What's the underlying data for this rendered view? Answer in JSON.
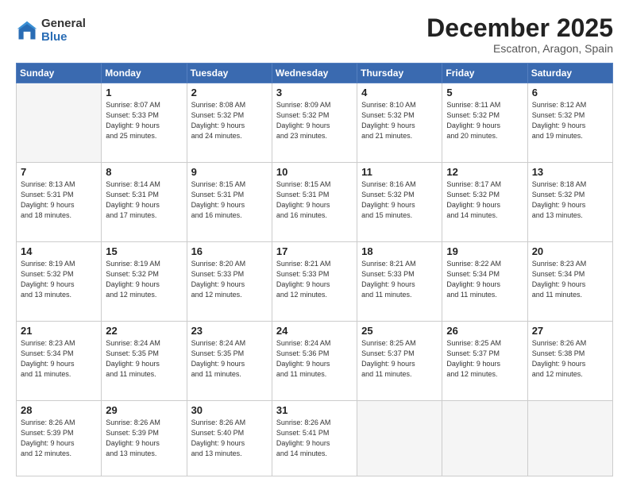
{
  "logo": {
    "general": "General",
    "blue": "Blue"
  },
  "title": "December 2025",
  "subtitle": "Escatron, Aragon, Spain",
  "weekdays": [
    "Sunday",
    "Monday",
    "Tuesday",
    "Wednesday",
    "Thursday",
    "Friday",
    "Saturday"
  ],
  "weeks": [
    [
      {
        "num": "",
        "info": ""
      },
      {
        "num": "1",
        "info": "Sunrise: 8:07 AM\nSunset: 5:33 PM\nDaylight: 9 hours\nand 25 minutes."
      },
      {
        "num": "2",
        "info": "Sunrise: 8:08 AM\nSunset: 5:32 PM\nDaylight: 9 hours\nand 24 minutes."
      },
      {
        "num": "3",
        "info": "Sunrise: 8:09 AM\nSunset: 5:32 PM\nDaylight: 9 hours\nand 23 minutes."
      },
      {
        "num": "4",
        "info": "Sunrise: 8:10 AM\nSunset: 5:32 PM\nDaylight: 9 hours\nand 21 minutes."
      },
      {
        "num": "5",
        "info": "Sunrise: 8:11 AM\nSunset: 5:32 PM\nDaylight: 9 hours\nand 20 minutes."
      },
      {
        "num": "6",
        "info": "Sunrise: 8:12 AM\nSunset: 5:32 PM\nDaylight: 9 hours\nand 19 minutes."
      }
    ],
    [
      {
        "num": "7",
        "info": "Sunrise: 8:13 AM\nSunset: 5:31 PM\nDaylight: 9 hours\nand 18 minutes."
      },
      {
        "num": "8",
        "info": "Sunrise: 8:14 AM\nSunset: 5:31 PM\nDaylight: 9 hours\nand 17 minutes."
      },
      {
        "num": "9",
        "info": "Sunrise: 8:15 AM\nSunset: 5:31 PM\nDaylight: 9 hours\nand 16 minutes."
      },
      {
        "num": "10",
        "info": "Sunrise: 8:15 AM\nSunset: 5:31 PM\nDaylight: 9 hours\nand 16 minutes."
      },
      {
        "num": "11",
        "info": "Sunrise: 8:16 AM\nSunset: 5:32 PM\nDaylight: 9 hours\nand 15 minutes."
      },
      {
        "num": "12",
        "info": "Sunrise: 8:17 AM\nSunset: 5:32 PM\nDaylight: 9 hours\nand 14 minutes."
      },
      {
        "num": "13",
        "info": "Sunrise: 8:18 AM\nSunset: 5:32 PM\nDaylight: 9 hours\nand 13 minutes."
      }
    ],
    [
      {
        "num": "14",
        "info": "Sunrise: 8:19 AM\nSunset: 5:32 PM\nDaylight: 9 hours\nand 13 minutes."
      },
      {
        "num": "15",
        "info": "Sunrise: 8:19 AM\nSunset: 5:32 PM\nDaylight: 9 hours\nand 12 minutes."
      },
      {
        "num": "16",
        "info": "Sunrise: 8:20 AM\nSunset: 5:33 PM\nDaylight: 9 hours\nand 12 minutes."
      },
      {
        "num": "17",
        "info": "Sunrise: 8:21 AM\nSunset: 5:33 PM\nDaylight: 9 hours\nand 12 minutes."
      },
      {
        "num": "18",
        "info": "Sunrise: 8:21 AM\nSunset: 5:33 PM\nDaylight: 9 hours\nand 11 minutes."
      },
      {
        "num": "19",
        "info": "Sunrise: 8:22 AM\nSunset: 5:34 PM\nDaylight: 9 hours\nand 11 minutes."
      },
      {
        "num": "20",
        "info": "Sunrise: 8:23 AM\nSunset: 5:34 PM\nDaylight: 9 hours\nand 11 minutes."
      }
    ],
    [
      {
        "num": "21",
        "info": "Sunrise: 8:23 AM\nSunset: 5:34 PM\nDaylight: 9 hours\nand 11 minutes."
      },
      {
        "num": "22",
        "info": "Sunrise: 8:24 AM\nSunset: 5:35 PM\nDaylight: 9 hours\nand 11 minutes."
      },
      {
        "num": "23",
        "info": "Sunrise: 8:24 AM\nSunset: 5:35 PM\nDaylight: 9 hours\nand 11 minutes."
      },
      {
        "num": "24",
        "info": "Sunrise: 8:24 AM\nSunset: 5:36 PM\nDaylight: 9 hours\nand 11 minutes."
      },
      {
        "num": "25",
        "info": "Sunrise: 8:25 AM\nSunset: 5:37 PM\nDaylight: 9 hours\nand 11 minutes."
      },
      {
        "num": "26",
        "info": "Sunrise: 8:25 AM\nSunset: 5:37 PM\nDaylight: 9 hours\nand 12 minutes."
      },
      {
        "num": "27",
        "info": "Sunrise: 8:26 AM\nSunset: 5:38 PM\nDaylight: 9 hours\nand 12 minutes."
      }
    ],
    [
      {
        "num": "28",
        "info": "Sunrise: 8:26 AM\nSunset: 5:39 PM\nDaylight: 9 hours\nand 12 minutes."
      },
      {
        "num": "29",
        "info": "Sunrise: 8:26 AM\nSunset: 5:39 PM\nDaylight: 9 hours\nand 13 minutes."
      },
      {
        "num": "30",
        "info": "Sunrise: 8:26 AM\nSunset: 5:40 PM\nDaylight: 9 hours\nand 13 minutes."
      },
      {
        "num": "31",
        "info": "Sunrise: 8:26 AM\nSunset: 5:41 PM\nDaylight: 9 hours\nand 14 minutes."
      },
      {
        "num": "",
        "info": ""
      },
      {
        "num": "",
        "info": ""
      },
      {
        "num": "",
        "info": ""
      }
    ]
  ]
}
